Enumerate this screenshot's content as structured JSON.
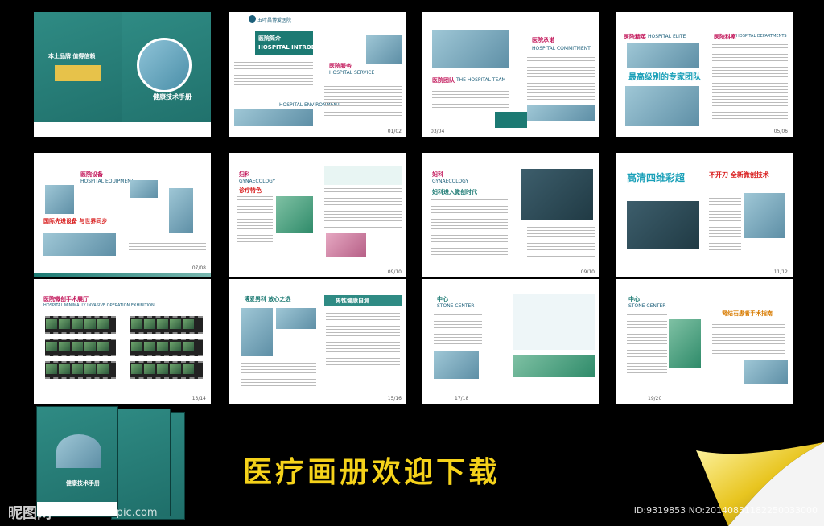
{
  "catalog_title": "医疗画册欢迎下载",
  "watermark": {
    "logo": "昵图网",
    "url": "www.nipic.com",
    "id": "ID:9319853 NO:20140831182250033000"
  },
  "hospital": {
    "name": "五叶昌博爱医院"
  },
  "spreads": [
    {
      "cover_slogan": "本土品牌 值得信赖",
      "cover_title": "健康技术手册"
    },
    {
      "intro_cn": "医院简介",
      "intro_en": "HOSPITAL INTRODUCTION",
      "service_cn": "医院服务",
      "service_en": "HOSPITAL SERVICE",
      "env_en": "HOSPITAL ENVIRONMENT",
      "page": "01/02"
    },
    {
      "team_cn": "医院团队",
      "team_en": "THE HOSPITAL TEAM",
      "promise_cn": "医院承诺",
      "promise_en": "HOSPITAL COMMITMENT",
      "page": "03/04"
    },
    {
      "elite_cn": "医院精英",
      "elite_en": "HOSPITAL ELITE",
      "dept_cn": "医院科室",
      "dept_en": "HOSPITAL DEPARTMENTS",
      "expert_banner": "最高级别的专家团队",
      "page": "05/06"
    },
    {
      "equip_cn": "医院设备",
      "equip_en": "HOSPITAL EQUIPMENT",
      "equip_slogan": "国际先进设备  与世界同步",
      "page": "07/08"
    },
    {
      "gyn_cn": "妇科",
      "gyn_en": "GYNAECOLOGY",
      "feature": "诊疗特色",
      "page": "09/10"
    },
    {
      "gyn_cn": "妇科",
      "gyn_en": "GYNAECOLOGY",
      "feature": "妇科进入微创时代",
      "page": "09/10"
    },
    {
      "ultra": "高清四维彩超",
      "tech": "不开刀 全新微创技术",
      "page": "11/12"
    },
    {
      "exhibit_cn": "医院微创手术展厅",
      "exhibit_en": "HOSPITAL MINIMALLY INVASIVE OPERATION EXHIBITION",
      "page": "13/14"
    },
    {
      "male_brand": "博爱男科  放心之选",
      "male_health": "男性健康自测",
      "page": "15/16"
    },
    {
      "stone_cn": "中心",
      "stone_en": "STONE CENTER",
      "page": "17/18"
    },
    {
      "stone_cn": "中心",
      "stone_en": "STONE CENTER",
      "stone_title": "肾结石患者手术指南",
      "page": "19/20"
    }
  ]
}
